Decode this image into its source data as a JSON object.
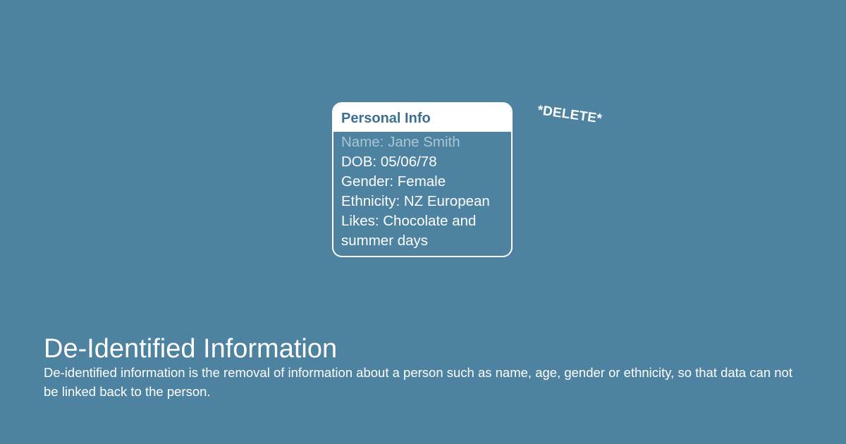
{
  "card": {
    "header": "Personal Info",
    "lines": [
      "Name: Jane Smith",
      "DOB: 05/06/78",
      "Gender: Female",
      "Ethnicity: NZ European",
      "Likes: Chocolate and summer days"
    ]
  },
  "delete_tag": "*DELETE*",
  "title": "De-Identified Information",
  "description": "De-identified information is the removal of information about a person such as name, age, gender or ethnicity, so that data can not be linked back to the person.",
  "colors": {
    "background": "#4d82a0",
    "header_text": "#3c7093",
    "faded_text": "#a9c5d6",
    "foreground": "#ffffff"
  }
}
